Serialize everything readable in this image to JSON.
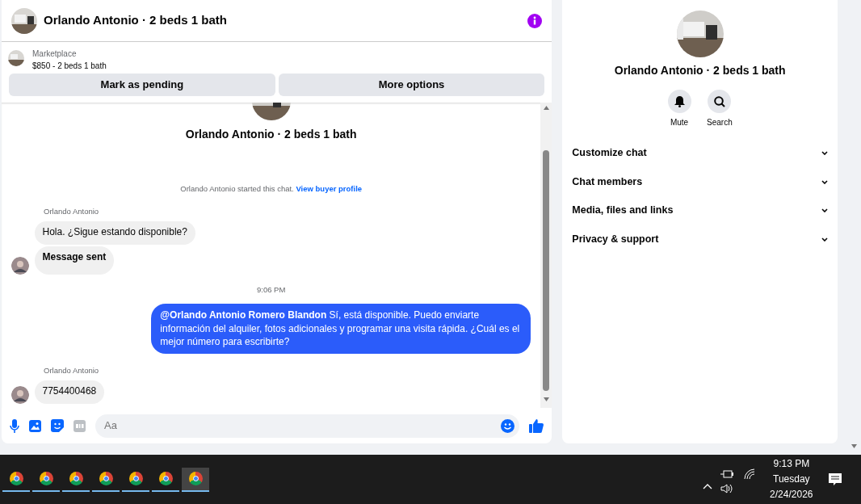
{
  "header": {
    "title": "Orlando Antonio · 2 beds 1 bath"
  },
  "listing": {
    "source": "Marketplace",
    "summary": "$850 - 2 beds 1 bath"
  },
  "actions": [
    "Mark as pending",
    "More options"
  ],
  "messages": [
    {
      "kind": "title",
      "text": "Orlando Antonio · 2 beds 1 bath"
    },
    {
      "kind": "system",
      "text": "Orlando Antonio started this chat.",
      "link": "View buyer profile"
    },
    {
      "kind": "sender",
      "text": "Orlando Antonio"
    },
    {
      "kind": "received",
      "text": "Hola. ¿Sigue estando disponible?",
      "avatar": false,
      "bold": false
    },
    {
      "kind": "received",
      "text": "Message sent",
      "avatar": true,
      "bold": true
    },
    {
      "kind": "time",
      "text": "9:06 PM"
    },
    {
      "kind": "sent",
      "text": "**@Orlando Antonio Romero Blandon** Sí, está disponible. Puedo enviarte información del alquiler, fotos adicionales y programar una visita rápida. ¿Cuál es el mejor número para escribirte?"
    },
    {
      "kind": "sender",
      "text": "Orlando Antonio"
    },
    {
      "kind": "received",
      "text": "7754400468",
      "avatar": true,
      "bold": false
    }
  ],
  "composer": {
    "placeholder": "Aa"
  },
  "details": {
    "title": "Orlando Antonio · 2 beds 1 bath",
    "buttons": [
      {
        "kind": "mute",
        "label": "Mute"
      },
      {
        "kind": "search",
        "label": "Search"
      }
    ],
    "sections": [
      {
        "label": "Customize chat",
        "expanded": false
      },
      {
        "label": "Chat members",
        "expanded": false
      },
      {
        "label": "Media, files and links",
        "expanded": false
      },
      {
        "label": "Privacy & support",
        "expanded": false
      }
    ]
  },
  "taskbar": {
    "apps": [
      {
        "selected": false
      },
      {
        "selected": false
      },
      {
        "selected": false
      },
      {
        "selected": false
      },
      {
        "selected": false
      },
      {
        "selected": false
      },
      {
        "selected": true
      }
    ],
    "time": "9:13 PM",
    "day": "Tuesday",
    "date": "2/24/2026"
  }
}
